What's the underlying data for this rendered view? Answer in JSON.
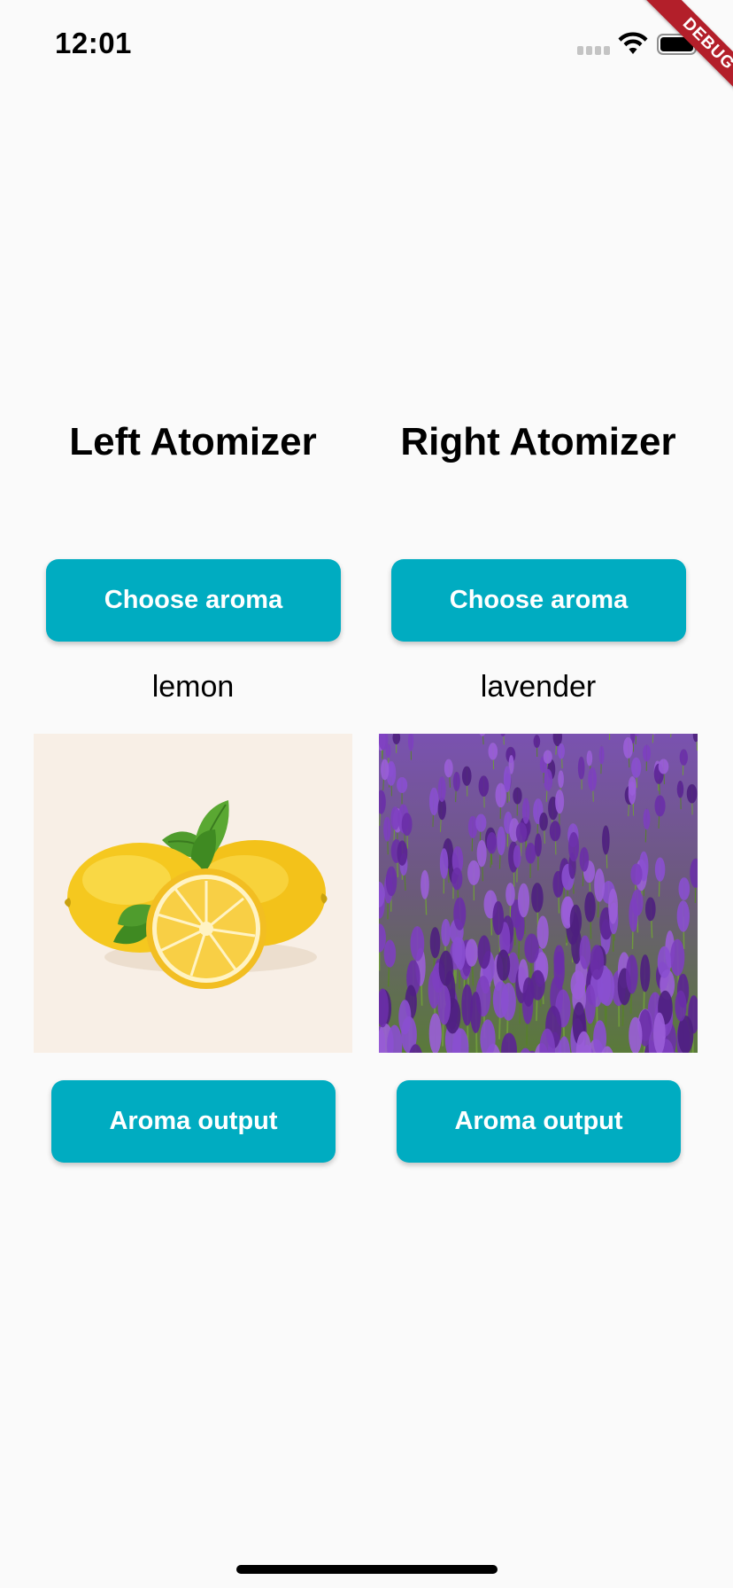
{
  "status_bar": {
    "time": "12:01"
  },
  "debug_banner": {
    "label": "DEBUG",
    "color": "#b31f2a"
  },
  "theme": {
    "accent": "#00acc1",
    "background": "#fafafa"
  },
  "left_atomizer": {
    "title": "Left Atomizer",
    "choose_label": "Choose aroma",
    "aroma": "lemon",
    "output_label": "Aroma output",
    "image": "lemon-photo"
  },
  "right_atomizer": {
    "title": "Right Atomizer",
    "choose_label": "Choose aroma",
    "aroma": "lavender",
    "output_label": "Aroma output",
    "image": "lavender-field-photo"
  }
}
